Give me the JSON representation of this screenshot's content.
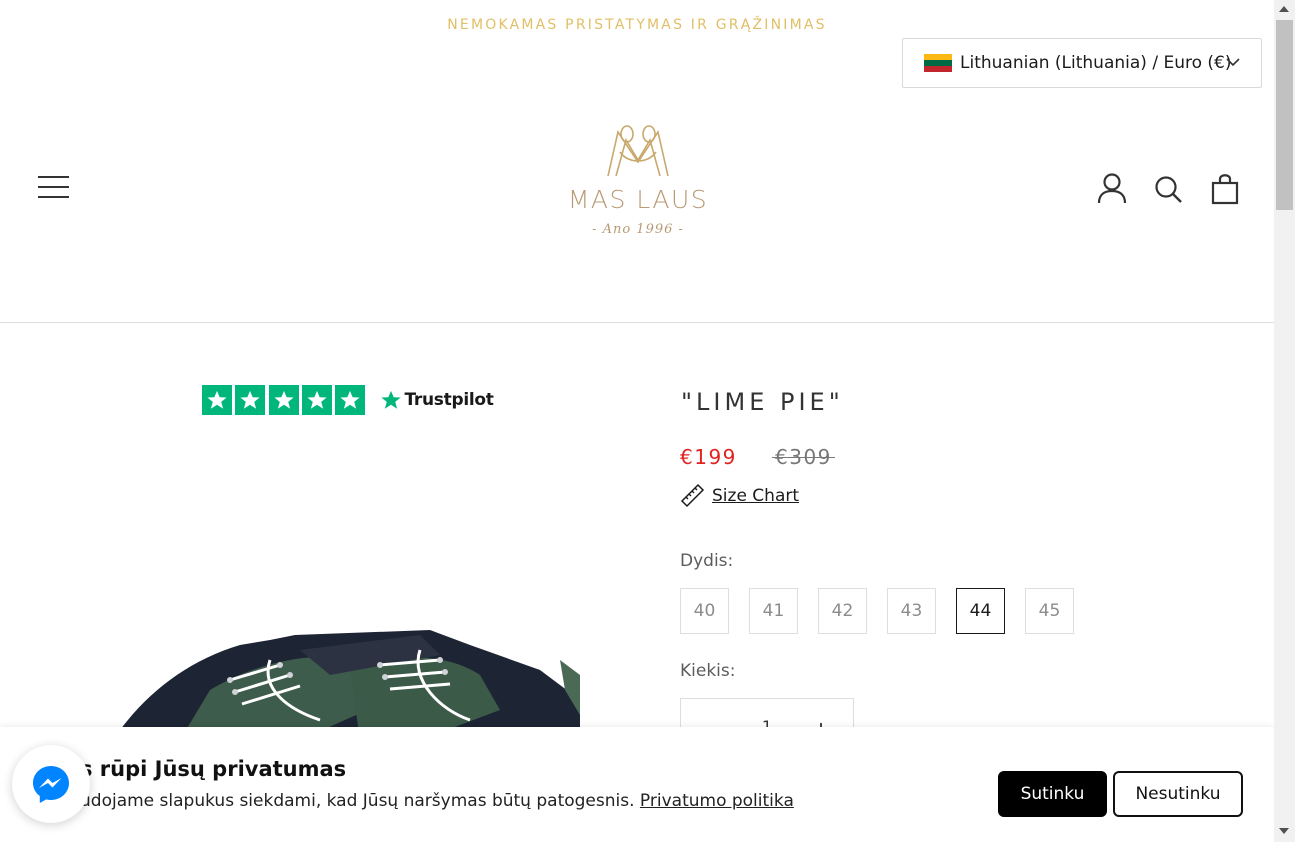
{
  "announcement": "NEMOKAMAS PRISTATYMAS IR GRĄŽINIMAS",
  "locale": {
    "label": "Lithuanian (Lithuania) / Euro (€)",
    "flag_colors": [
      "#fdb913",
      "#006a44",
      "#c1272d"
    ]
  },
  "header": {
    "menu_icon": "hamburger-icon",
    "logo": {
      "name": "MAS LAUS",
      "tagline": "- Ano 1996 -"
    },
    "icons": [
      "account-icon",
      "search-icon",
      "cart-icon"
    ]
  },
  "trustpilot": {
    "stars": 5,
    "brand": "Trustpilot",
    "color": "#00b67a"
  },
  "product": {
    "title": "\"LIME PIE\"",
    "price": "€199",
    "compare_price": "€309",
    "size_chart_label": "Size Chart",
    "size_label": "Dydis:",
    "sizes": [
      "40",
      "41",
      "42",
      "43",
      "44",
      "45"
    ],
    "selected_size": "44",
    "quantity_label": "Kiekis:",
    "quantity": "1"
  },
  "cookie": {
    "title": "s rūpi Jūsų privatumas",
    "text": "udojame slapukus siekdami, kad Jūsų naršymas būtų patogesnis.",
    "link": "Privatumo politika",
    "accept": "Sutinku",
    "decline": "Nesutinku"
  },
  "colors": {
    "accent_gold": "#e0bf66",
    "sale_red": "#e22120",
    "messenger_blue": "#0084ff"
  }
}
